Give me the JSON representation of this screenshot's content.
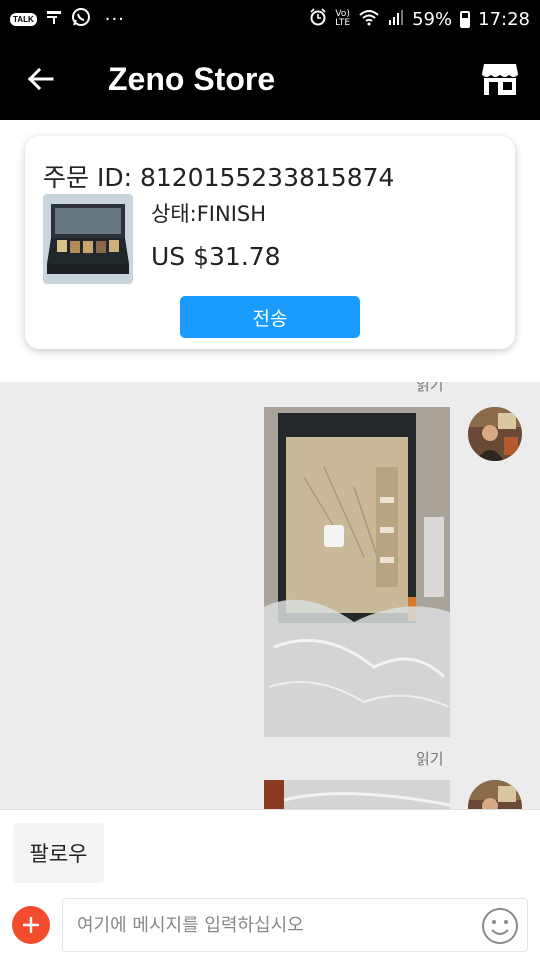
{
  "status_bar": {
    "talk_badge": "TALK",
    "dots": "···",
    "volte": "Vo)\nLTE",
    "battery": "59%",
    "time": "17:28"
  },
  "app_bar": {
    "title": "Zeno Store",
    "back_icon": "arrow-left-icon",
    "store_icon": "storefront-icon"
  },
  "order": {
    "id_text": "주문 ID: 8120155233815874",
    "status_text": "상태:FINISH",
    "price_text": "US $31.78",
    "send_label": "전송"
  },
  "chat": {
    "read_label_top": "읽기",
    "read_label_mid": "읽기"
  },
  "bottom": {
    "follow_label": "팔로우",
    "input_placeholder": "여기에 메시지를 입력하십시오",
    "input_value": ""
  },
  "colors": {
    "header_bg": "#000000",
    "accent_blue": "#1a9bff",
    "accent_red": "#f24b2d",
    "chat_bg": "#ececec"
  }
}
